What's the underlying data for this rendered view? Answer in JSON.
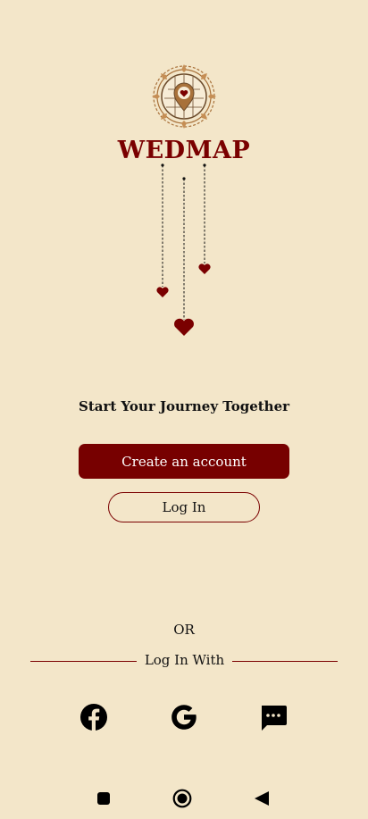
{
  "brand": {
    "name": "WEDMAP",
    "logo_icon": "wedding-map-pin-emblem-icon",
    "accent": "#7a0000",
    "background": "#f3e6c9"
  },
  "hanging_hearts": [
    "heart-icon",
    "heart-icon",
    "heart-icon"
  ],
  "tagline": "Start Your Journey Together",
  "actions": {
    "create_label": "Create an account",
    "login_label": "Log In"
  },
  "divider": {
    "or_text": "OR",
    "login_with": "Log In With"
  },
  "social": [
    {
      "name": "facebook-icon"
    },
    {
      "name": "google-icon"
    },
    {
      "name": "sms-message-icon"
    }
  ],
  "system_nav": {
    "recents": "square-icon",
    "home": "circle-home-icon",
    "back": "triangle-back-icon"
  }
}
